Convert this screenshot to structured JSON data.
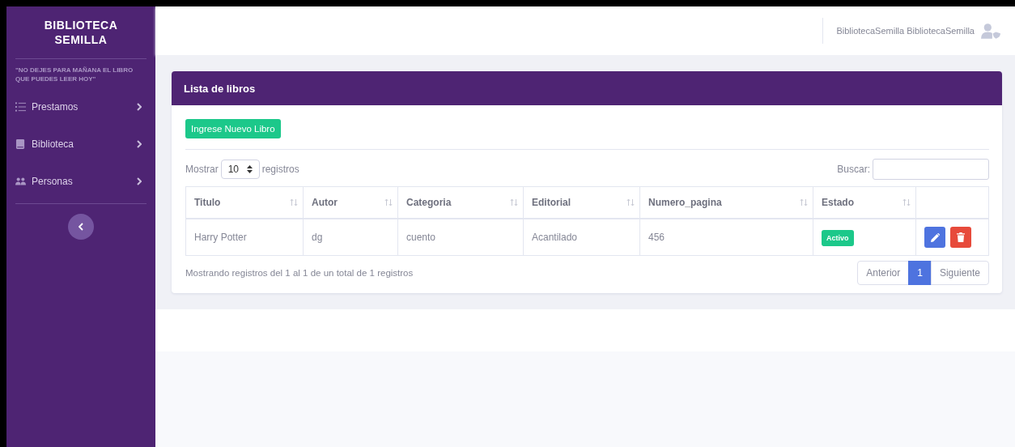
{
  "sidebar": {
    "brand": "BIBLIOTECA SEMILLA",
    "motto": "\"NO DEJES PARA MAÑANA EL LIBRO QUE PUEDES LEER HOY\"",
    "items": [
      {
        "kind": "list",
        "label": "Prestamos"
      },
      {
        "kind": "book",
        "label": "Biblioteca"
      },
      {
        "kind": "people",
        "label": "Personas"
      }
    ]
  },
  "topbar": {
    "user": "BibliotecaSemilla BibliotecaSemilla"
  },
  "card": {
    "title": "Lista de libros",
    "new_button": "Ingrese Nuevo Libro",
    "length": {
      "prefix": "Mostrar",
      "value": "10",
      "suffix": "registros"
    },
    "search": {
      "label": "Buscar:"
    },
    "table": {
      "columns": [
        "Titulo",
        "Autor",
        "Categoria",
        "Editorial",
        "Numero_pagina",
        "Estado"
      ],
      "rows": [
        {
          "cells": [
            "Harry Potter",
            "dg",
            "cuento",
            "Acantilado",
            "456"
          ],
          "status": "Activo"
        }
      ]
    },
    "info": "Mostrando registros del 1 al 1 de un total de 1 registros",
    "pagination": [
      {
        "label": "Anterior",
        "selected": false
      },
      {
        "label": "1",
        "selected": true
      },
      {
        "label": "Siguiente",
        "selected": false
      }
    ]
  }
}
